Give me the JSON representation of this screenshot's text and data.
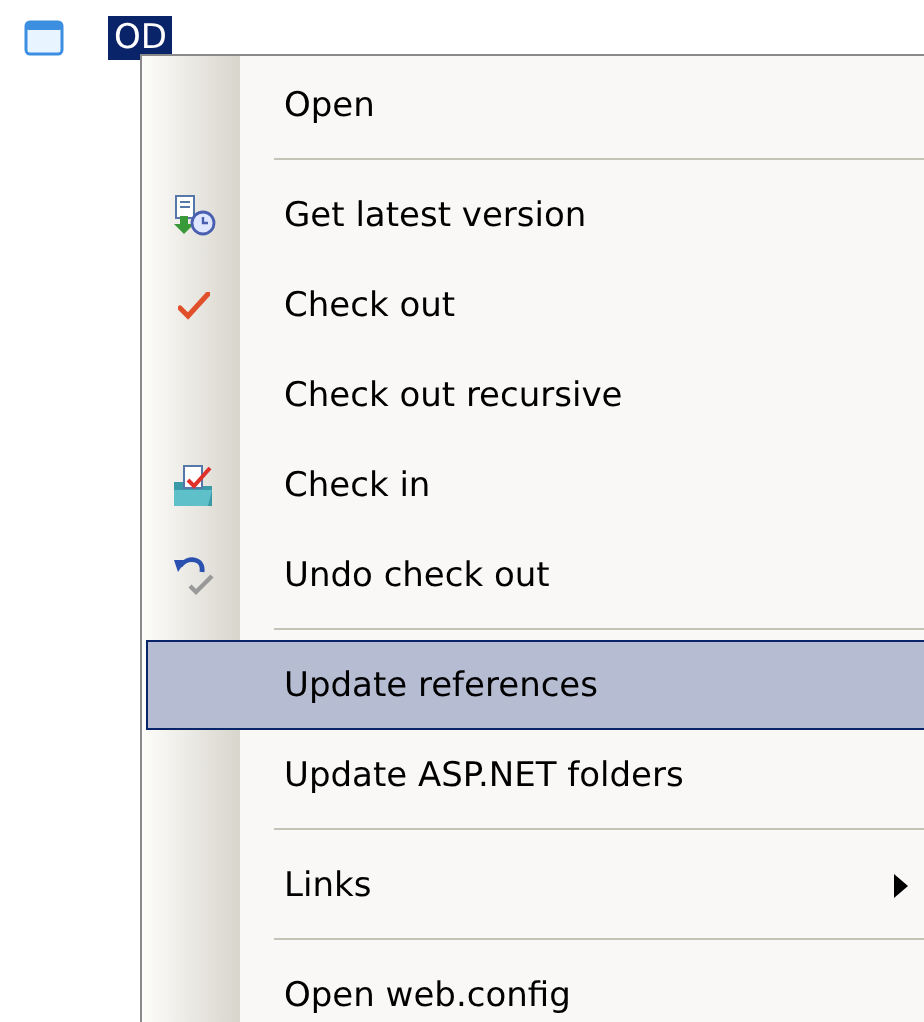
{
  "tree_node": {
    "label": "OD",
    "selected": true
  },
  "menu": [
    {
      "kind": "plain",
      "label": "Open",
      "selected": false
    },
    {
      "kind": "separator"
    },
    {
      "kind": "get_latest",
      "label": "Get latest version",
      "selected": false
    },
    {
      "kind": "check_out",
      "label": "Check out",
      "selected": false
    },
    {
      "kind": "plain",
      "label": "Check out recursive",
      "selected": false
    },
    {
      "kind": "check_in",
      "label": "Check in",
      "selected": false
    },
    {
      "kind": "undo",
      "label": "Undo check out",
      "selected": false
    },
    {
      "kind": "separator"
    },
    {
      "kind": "plain",
      "label": "Update references",
      "selected": true
    },
    {
      "kind": "plain",
      "label": "Update ASP.NET folders",
      "selected": false
    },
    {
      "kind": "separator"
    },
    {
      "kind": "submenu",
      "label": "Links",
      "selected": false
    },
    {
      "kind": "separator"
    },
    {
      "kind": "plain",
      "label": "Open web.config",
      "selected": false
    }
  ]
}
